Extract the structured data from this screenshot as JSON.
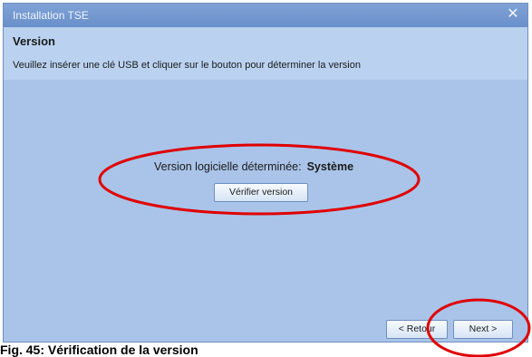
{
  "window": {
    "title": "Installation TSE"
  },
  "header": {
    "title": "Version",
    "instruction": "Veuillez insérer une clé USB et cliquer sur le bouton pour déterminer la version"
  },
  "main": {
    "version_label": "Version logicielle déterminée:",
    "version_value": "Système",
    "verify_button": "Vérifier version"
  },
  "footer": {
    "back_button": "< Retour",
    "next_button": "Next >"
  },
  "caption": "Fig. 45: Vérification de la version",
  "colors": {
    "window_bg": "#a9c4e8",
    "titlebar": "#6a8fc9",
    "highlight": "#e00000"
  }
}
